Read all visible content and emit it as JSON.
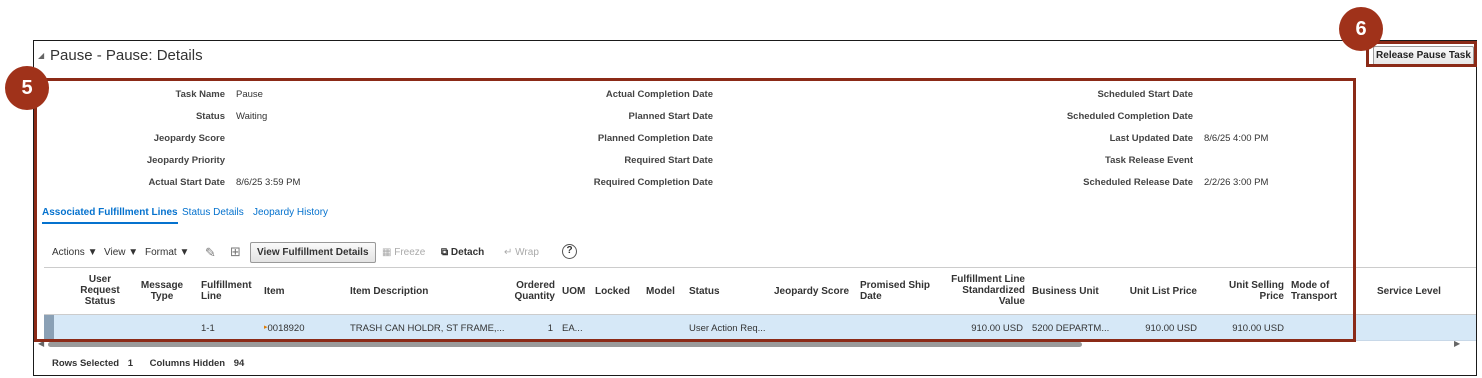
{
  "header": {
    "title": "Pause - Pause: Details",
    "release_button": "Release Pause Task"
  },
  "callouts": {
    "five": "5",
    "six": "6"
  },
  "details": {
    "col1": [
      {
        "label": "Task Name",
        "value": "Pause"
      },
      {
        "label": "Status",
        "value": "Waiting"
      },
      {
        "label": "Jeopardy Score",
        "value": ""
      },
      {
        "label": "Jeopardy Priority",
        "value": ""
      },
      {
        "label": "Actual Start Date",
        "value": "8/6/25 3:59 PM"
      }
    ],
    "col2": [
      {
        "label": "Actual Completion Date",
        "value": ""
      },
      {
        "label": "Planned Start Date",
        "value": ""
      },
      {
        "label": "Planned Completion Date",
        "value": ""
      },
      {
        "label": "Required Start Date",
        "value": ""
      },
      {
        "label": "Required Completion Date",
        "value": ""
      }
    ],
    "col3": [
      {
        "label": "Scheduled Start Date",
        "value": ""
      },
      {
        "label": "Scheduled Completion Date",
        "value": ""
      },
      {
        "label": "Last Updated Date",
        "value": "8/6/25 4:00 PM"
      },
      {
        "label": "Task Release Event",
        "value": ""
      },
      {
        "label": "Scheduled Release Date",
        "value": "2/2/26 3:00 PM"
      }
    ]
  },
  "tabs": [
    {
      "label": "Associated Fulfillment Lines"
    },
    {
      "label": "Status Details"
    },
    {
      "label": "Jeopardy History"
    }
  ],
  "toolbar": {
    "actions": "Actions",
    "view": "View",
    "format": "Format",
    "view_fulfillment_details": "View Fulfillment Details",
    "freeze": "Freeze",
    "detach": "Detach",
    "wrap": "Wrap",
    "help_glyph": "?"
  },
  "table": {
    "headers": {
      "user_request_status": "User Request Status",
      "message_type": "Message Type",
      "fulfillment_line": "Fulfillment Line",
      "item": "Item",
      "item_description": "Item Description",
      "ordered_quantity": "Ordered Quantity",
      "uom": "UOM",
      "locked": "Locked",
      "model": "Model",
      "status": "Status",
      "jeopardy_score": "Jeopardy Score",
      "promised_ship_date": "Promised Ship Date",
      "standardized_value": "Fulfillment Line Standardized Value",
      "business_unit": "Business Unit",
      "unit_list_price": "Unit List Price",
      "unit_selling_price": "Unit Selling Price",
      "mode_of_transport": "Mode of Transport",
      "service_level": "Service Level"
    },
    "row": {
      "fulfillment_line": "1-1",
      "item": "0018920",
      "item_description": "TRASH CAN HOLDR, ST FRAME,...",
      "ordered_quantity": "1",
      "uom": "EA...",
      "status": "User Action Req...",
      "standardized_value": "910.00 USD",
      "business_unit": "5200 DEPARTM...",
      "unit_list_price": "910.00 USD",
      "unit_selling_price": "910.00 USD"
    }
  },
  "footer": {
    "rows_selected_label": "Rows Selected",
    "rows_selected_value": "1",
    "columns_hidden_label": "Columns Hidden",
    "columns_hidden_value": "94"
  },
  "colors": {
    "callout": "#a0321a",
    "link": "#0572ce",
    "selected_row": "#d6e8f7"
  }
}
